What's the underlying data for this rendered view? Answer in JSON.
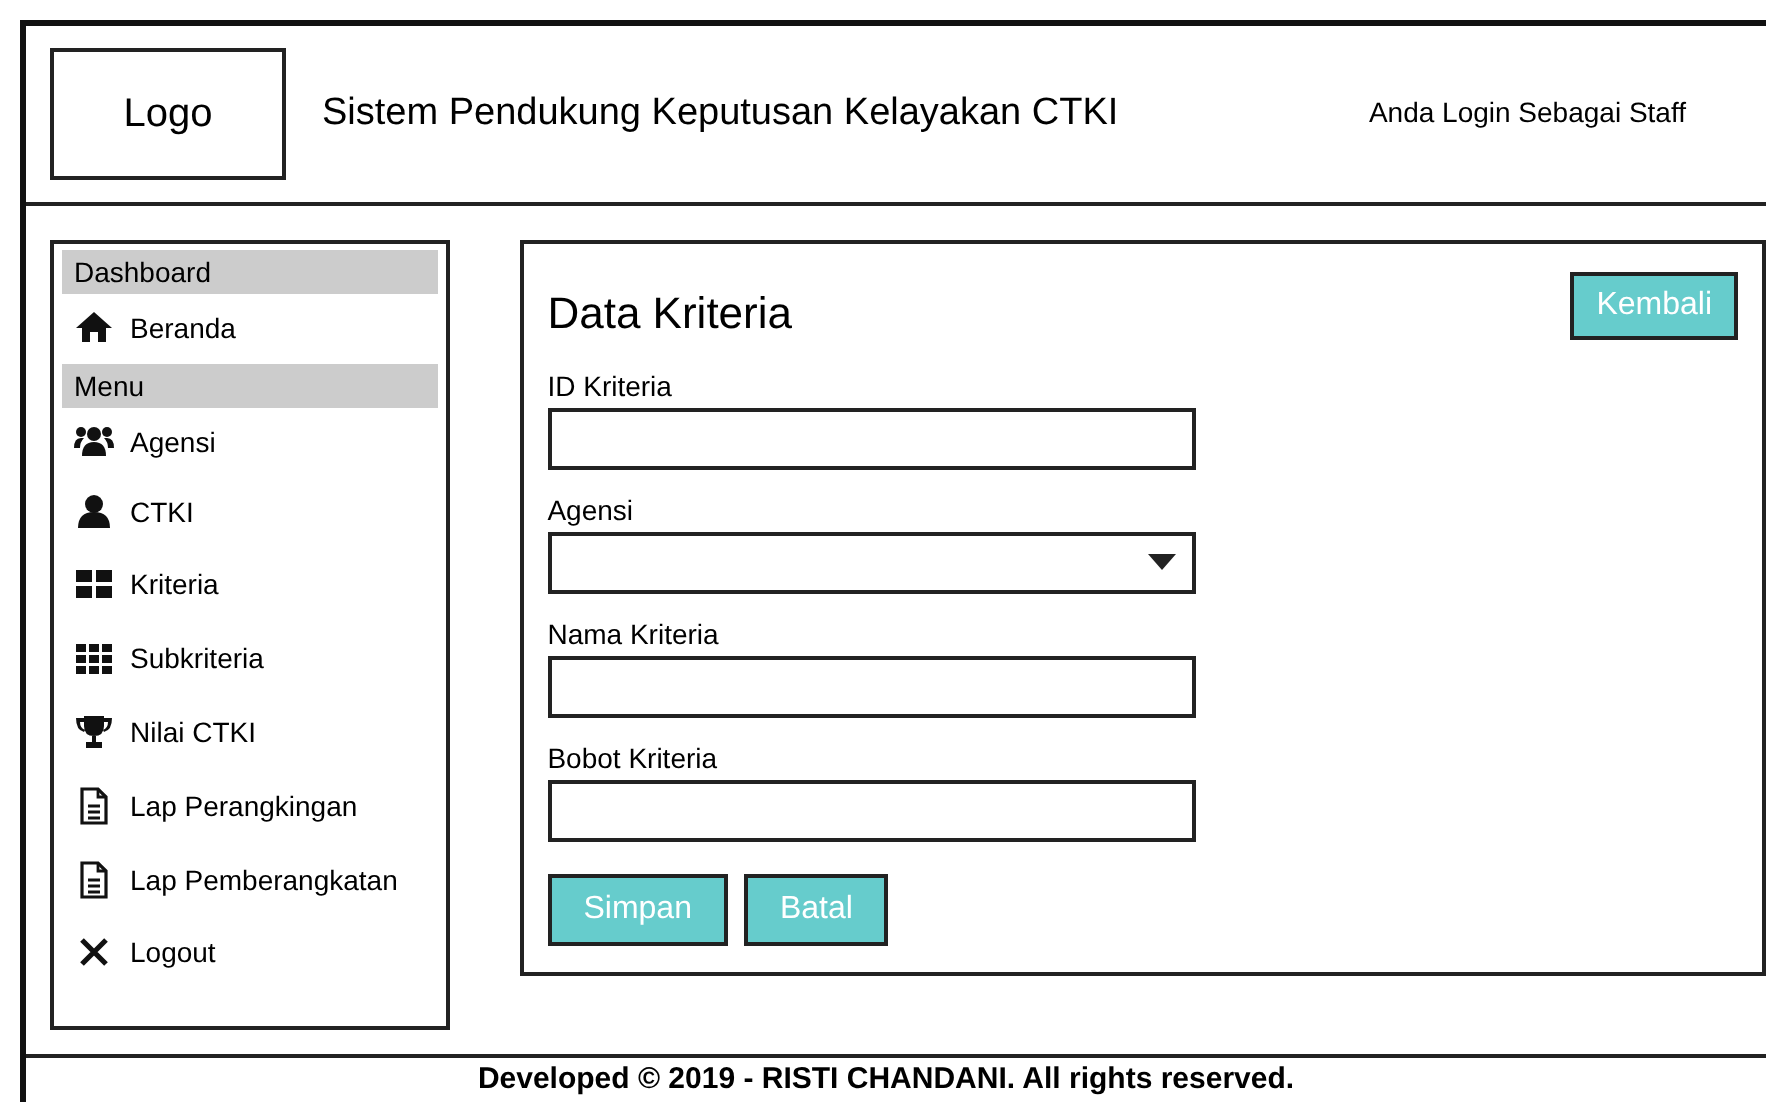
{
  "header": {
    "logo": "Logo",
    "title": "Sistem Pendukung Keputusan Kelayakan CTKI",
    "user_text": "Anda Login Sebagai Staff"
  },
  "sidebar": {
    "items": [
      {
        "kind": "section",
        "label": "Dashboard"
      },
      {
        "kind": "link",
        "label": "Beranda"
      },
      {
        "kind": "section",
        "label": "Menu"
      },
      {
        "kind": "link",
        "label": "Agensi"
      },
      {
        "kind": "link",
        "label": "CTKI"
      },
      {
        "kind": "link",
        "label": "Kriteria"
      },
      {
        "kind": "link",
        "label": "Subkriteria"
      },
      {
        "kind": "link",
        "label": "Nilai CTKI"
      },
      {
        "kind": "link",
        "label": "Lap Perangkingan"
      },
      {
        "kind": "link",
        "label": "Lap Pemberangkatan"
      },
      {
        "kind": "link",
        "label": "Logout"
      }
    ]
  },
  "form": {
    "title": "Data Kriteria",
    "back_button": "Kembali",
    "fields": [
      {
        "kind": "text",
        "label": "ID Kriteria"
      },
      {
        "kind": "select",
        "label": "Agensi"
      },
      {
        "kind": "text",
        "label": "Nama Kriteria"
      },
      {
        "kind": "text",
        "label": "Bobot Kriteria"
      }
    ],
    "buttons": [
      "Simpan",
      "Batal"
    ]
  },
  "footer": "Developed © 2019 - RISTI CHANDANI. All rights reserved."
}
